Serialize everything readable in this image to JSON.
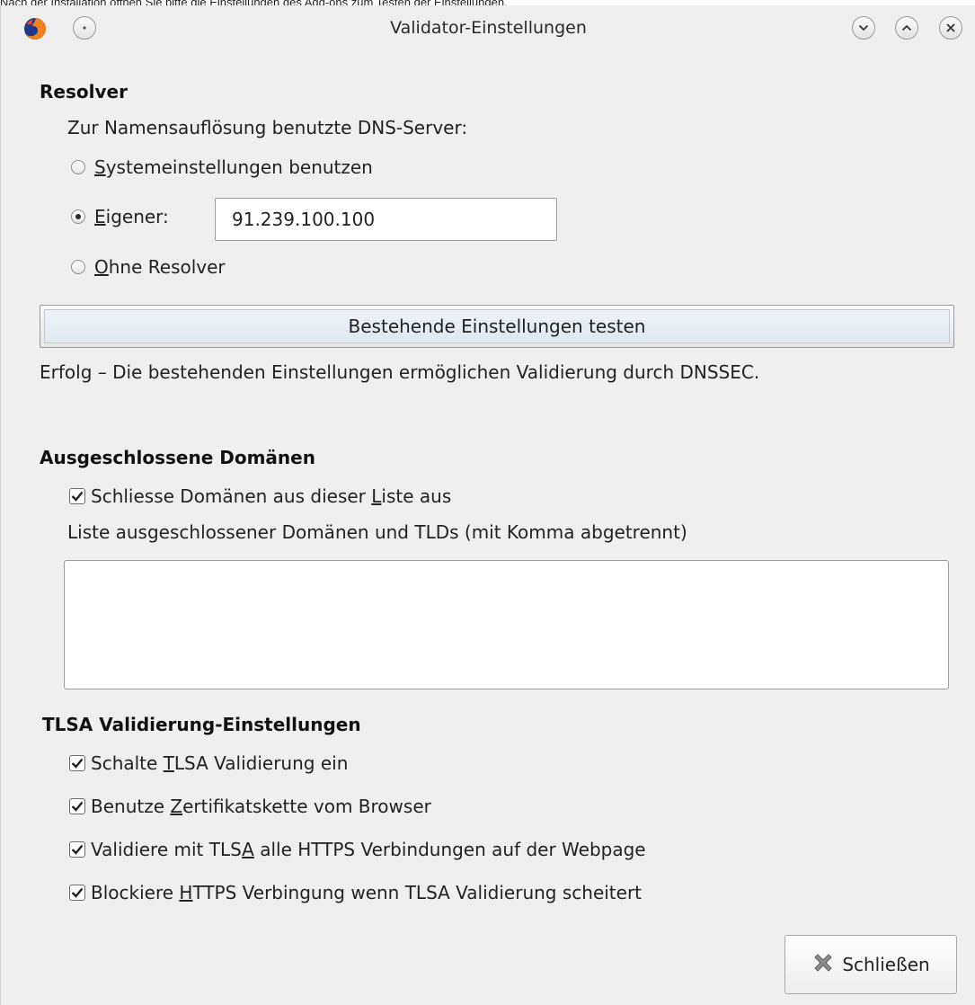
{
  "caption": "Nach der Installation öffnen Sie bitte die Einstellungen des Add-ons zum Testen der Einstellungen.",
  "window": {
    "title": "Validator-Einstellungen",
    "icons": [
      "firefox-icon",
      "window-menu-icon",
      "minimize-icon",
      "maximize-icon",
      "close-icon"
    ]
  },
  "resolver": {
    "heading": "Resolver",
    "label": "Zur Namensauflösung benutzte DNS-Server:",
    "options": [
      {
        "mnemonic": "S",
        "rest": "ystemeinstellungen benutzen",
        "checked": false
      },
      {
        "mnemonic": "E",
        "rest": "igener:",
        "checked": true
      },
      {
        "mnemonic": "O",
        "rest": "hne Resolver",
        "checked": false
      }
    ],
    "custom_dns_value": "91.239.100.100",
    "test_button": "Bestehende Einstellungen testen",
    "status": "Erfolg – Die bestehenden Einstellungen ermöglichen Validierung durch DNSSEC."
  },
  "excluded": {
    "heading": "Ausgeschlossene Domänen",
    "checkbox": {
      "before": "Schliesse Domänen aus dieser ",
      "mnemonic": "L",
      "after": "iste aus",
      "checked": true
    },
    "list_label": "Liste ausgeschlossener Domänen und TLDs (mit Komma abgetrennt)",
    "list_value": ""
  },
  "tlsa": {
    "heading": "TLSA Validierung-Einstellungen",
    "options": [
      {
        "before": "Schalte ",
        "mnemonic": "T",
        "after": "LSA Validierung ein",
        "checked": true
      },
      {
        "before": "Benutze ",
        "mnemonic": "Z",
        "after": "ertifikatskette vom Browser",
        "checked": true
      },
      {
        "before": "Validiere mit TLS",
        "mnemonic": "A",
        "after": " alle HTTPS Verbindungen auf der Webpage",
        "checked": true
      },
      {
        "before": "Blockiere ",
        "mnemonic": "H",
        "after": "TTPS Verbingung wenn TLSA Validierung scheitert",
        "checked": true
      }
    ]
  },
  "footer": {
    "close_button": "Schließen",
    "close_icon": "x-icon"
  },
  "colors": {
    "dialog_bg": "#efefef",
    "button_highlight": "#dfe7ef"
  }
}
